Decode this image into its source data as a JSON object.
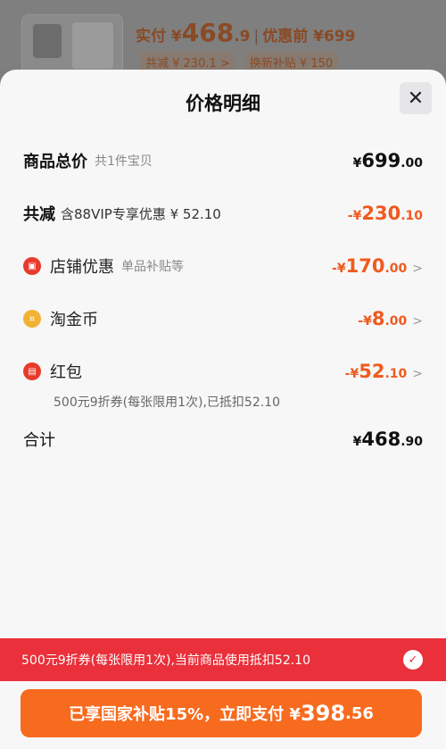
{
  "product": {
    "price_prefix": "实付 ¥",
    "price_int": "468",
    "price_dec": ".9",
    "price_separator": "|",
    "original_label": "优惠前 ¥699",
    "tag_reduce": "共减 ¥ 230.1 >",
    "tag_subsidy": "换新补贴 ¥ 150"
  },
  "sheet": {
    "title": "价格明细",
    "close_glyph": "✕"
  },
  "rows": {
    "total": {
      "label": "商品总价",
      "sub": "共1件宝贝",
      "currency": "¥",
      "int": "699",
      "dec": ".00"
    },
    "reduce": {
      "label": "共减",
      "sub": "含88VIP专享优惠 ¥ 52.10",
      "currency": "-¥",
      "int": "230",
      "dec": ".10"
    },
    "store": {
      "label": "店铺优惠",
      "sub": "单品补贴等",
      "currency": "-¥",
      "int": "170",
      "dec": ".00",
      "icon": "store-icon"
    },
    "coin": {
      "label": "淘金币",
      "currency": "-¥",
      "int": "8",
      "dec": ".00",
      "icon": "coin-icon"
    },
    "redpacket": {
      "label": "红包",
      "currency": "-¥",
      "int": "52",
      "dec": ".10",
      "icon": "red-packet-icon",
      "note": "500元9折券(每张限用1次),已抵扣52.10"
    },
    "sum": {
      "label": "合计",
      "currency": "¥",
      "int": "468",
      "dec": ".90"
    }
  },
  "coupon_bar": {
    "text": "500元9折券(每张限用1次),当前商品使用抵扣52.10",
    "check_glyph": "✓"
  },
  "pay_button": {
    "prefix": "已享国家补贴15%，立即支付 ¥",
    "int": "398",
    "dec": ".56"
  },
  "colors": {
    "accent_orange": "#f05a1e",
    "coupon_red": "#e9303b",
    "pay_orange": "#f76b1f"
  },
  "chevron": ">"
}
